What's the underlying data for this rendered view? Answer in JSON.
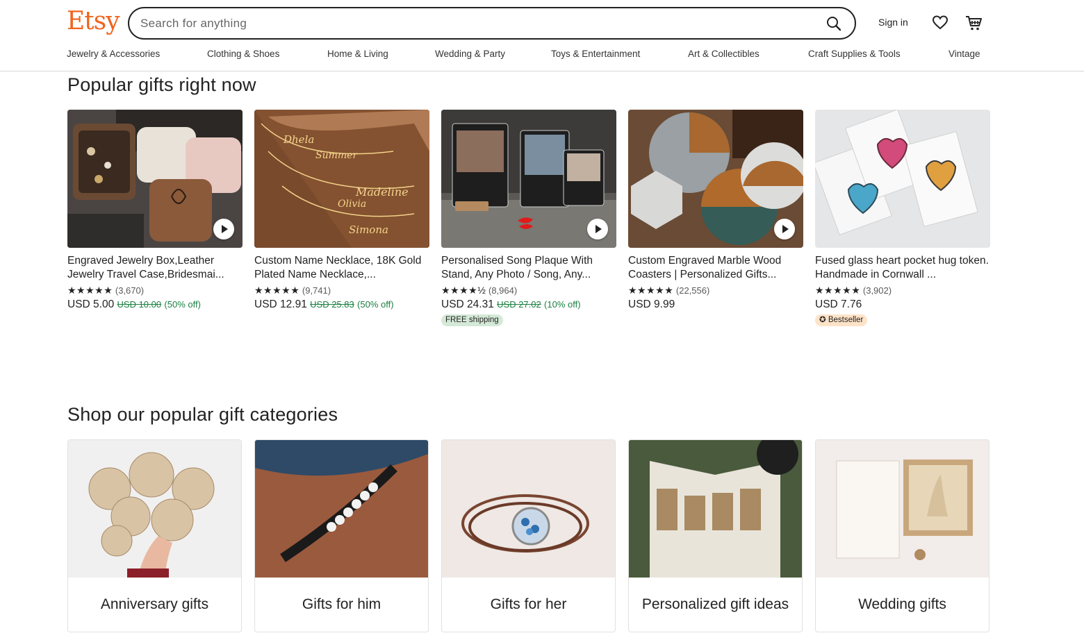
{
  "header": {
    "logo": "Etsy",
    "search_placeholder": "Search for anything",
    "sign_in": "Sign in"
  },
  "nav": [
    "Jewelry & Accessories",
    "Clothing & Shoes",
    "Home & Living",
    "Wedding & Party",
    "Toys & Entertainment",
    "Art & Collectibles",
    "Craft Supplies & Tools",
    "Vintage"
  ],
  "popular": {
    "title": "Popular gifts right now",
    "products": [
      {
        "title": "Engraved Jewelry Box,Leather Jewelry Travel Case,Bridesmai...",
        "stars": "★★★★★",
        "reviews": "(3,670)",
        "price": "USD 5.00",
        "original_price": "USD 10.00",
        "discount": "(50% off)",
        "badge": ""
      },
      {
        "title": "Custom Name Necklace, 18K Gold Plated Name Necklace,...",
        "stars": "★★★★★",
        "reviews": "(9,741)",
        "price": "USD 12.91",
        "original_price": "USD 25.83",
        "discount": "(50% off)",
        "badge": ""
      },
      {
        "title": "Personalised Song Plaque With Stand, Any Photo / Song, Any...",
        "stars": "★★★★½",
        "reviews": "(8,964)",
        "price": "USD 24.31",
        "original_price": "USD 27.02",
        "discount": "(10% off)",
        "badge": "FREE shipping"
      },
      {
        "title": "Custom Engraved Marble Wood Coasters | Personalized Gifts...",
        "stars": "★★★★★",
        "reviews": "(22,556)",
        "price": "USD 9.99",
        "original_price": "",
        "discount": "",
        "badge": ""
      },
      {
        "title": "Fused glass heart pocket hug token. Handmade in Cornwall ...",
        "stars": "★★★★★",
        "reviews": "(3,902)",
        "price": "USD 7.76",
        "original_price": "",
        "discount": "",
        "badge": "Bestseller"
      }
    ]
  },
  "categories": {
    "title": "Shop our popular gift categories",
    "items": [
      "Anniversary gifts",
      "Gifts for him",
      "Gifts for her",
      "Personalized gift ideas",
      "Wedding gifts"
    ]
  },
  "colors": {
    "brand": "#f1641e",
    "discount_green": "#1b7f42",
    "free_shipping_bg": "#d4e9d7",
    "bestseller_bg": "#fde3c8"
  },
  "icons": [
    "search-icon",
    "heart-icon",
    "cart-icon",
    "play-icon",
    "bestseller-icon"
  ]
}
